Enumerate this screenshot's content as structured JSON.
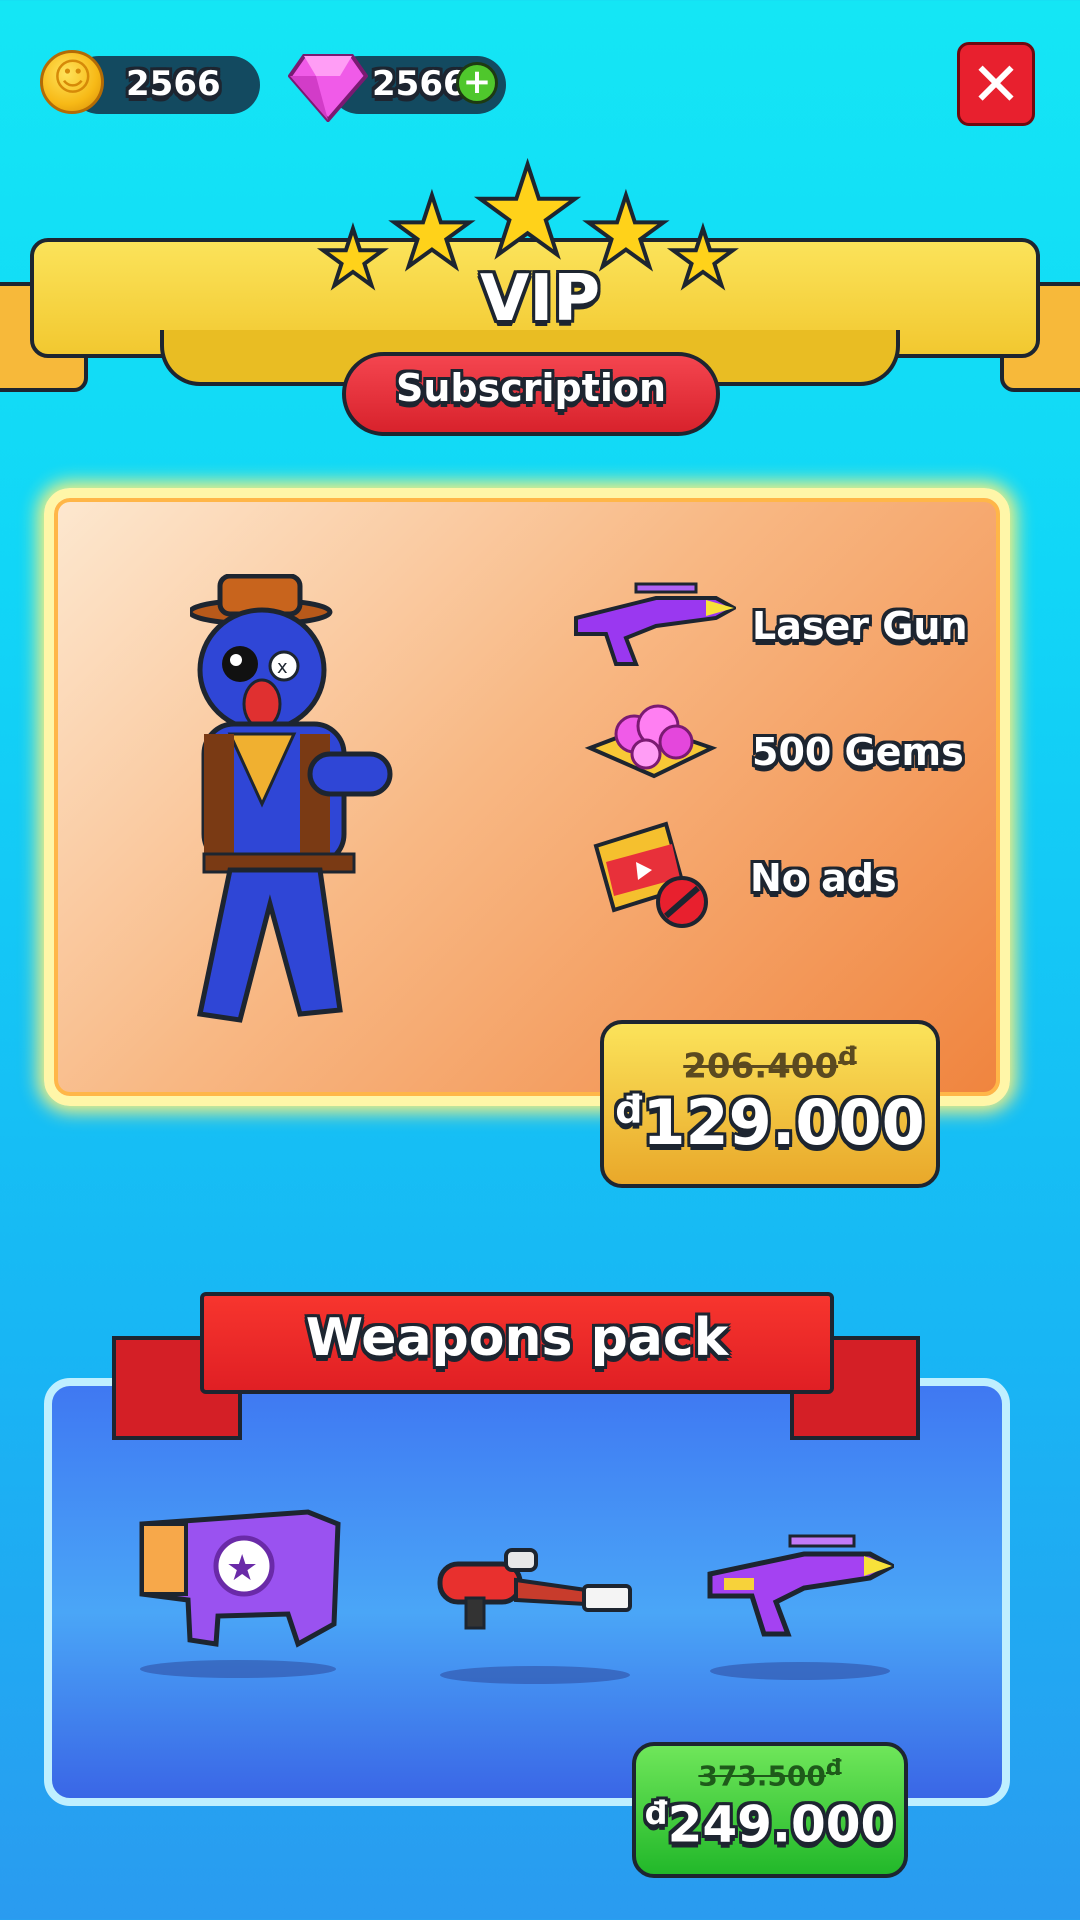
{
  "currency": {
    "coins": "2566",
    "gems": "2566"
  },
  "vip": {
    "title": "VIP",
    "subtitle": "Subscription",
    "perks": [
      {
        "label": "Laser Gun",
        "icon": "laser-gun-icon"
      },
      {
        "label": "500 Gems",
        "icon": "gems-chest-icon"
      },
      {
        "label": "No ads",
        "icon": "no-ads-icon"
      }
    ],
    "old_price": "206.400",
    "old_currency": "đ",
    "price": "129.000",
    "currency_symbol": "đ"
  },
  "weapons_pack": {
    "title": "Weapons pack",
    "items": [
      "launcher-weapon-icon",
      "flamethrower-weapon-icon",
      "laser-gun-weapon-icon"
    ],
    "old_price": "373.500",
    "old_currency": "đ",
    "price": "249.000",
    "currency_symbol": "đ"
  },
  "colors": {
    "accent_red": "#e8202e",
    "gold": "#fbe35a",
    "green": "#22b82a"
  }
}
